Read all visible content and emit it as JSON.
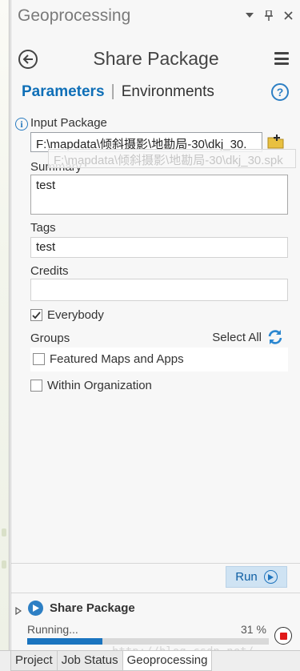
{
  "pane": {
    "title": "Geoprocessing",
    "header_icons": [
      "dropdown-icon",
      "pin-icon",
      "close-icon"
    ]
  },
  "tool": {
    "title": "Share Package"
  },
  "tabs": {
    "parameters": "Parameters",
    "environments": "Environments"
  },
  "help_label": "?",
  "params": {
    "input_package_label": "Input Package",
    "input_package_value": "F:\\mapdata\\倾斜摄影\\地勘局-30\\dkj_30.",
    "input_package_tooltip": "F:\\mapdata\\倾斜摄影\\地勘局-30\\dkj_30.spk",
    "summary_label": "Summary",
    "summary_value": "test",
    "tags_label": "Tags",
    "tags_value": "test",
    "credits_label": "Credits",
    "credits_value": "",
    "everybody_label": "Everybody",
    "everybody_checked": true,
    "groups_label": "Groups",
    "select_all_label": "Select All",
    "featured_label": "Featured Maps and Apps",
    "featured_checked": false,
    "within_org_label": "Within Organization",
    "within_org_checked": false
  },
  "run": {
    "label": "Run"
  },
  "job": {
    "title": "Share Package",
    "status": "Running...",
    "percent_label": "31 %",
    "progress": 0.31
  },
  "watermark": "http://blog.csdn.net/",
  "bottom_tabs": [
    "Project",
    "Job Status",
    "Geoprocessing"
  ],
  "colors": {
    "accent": "#0f6fb7",
    "run_button": "#cfe3f3",
    "progress": "#1a74bf",
    "stop": "#e01818"
  }
}
